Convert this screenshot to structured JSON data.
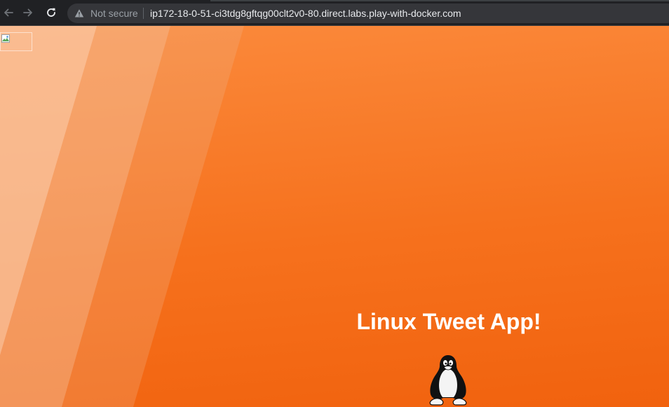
{
  "browser": {
    "security_label": "Not secure",
    "url": "ip172-18-0-51-ci3tdg8gftqg00clt2v0-80.direct.labs.play-with-docker.com",
    "icons": {
      "back": "arrow-left-icon",
      "forward": "arrow-right-icon",
      "reload": "reload-icon",
      "security": "warning-triangle-icon"
    }
  },
  "page": {
    "title": "Linux Tweet App!",
    "logo": "tux-penguin-icon",
    "broken_image": "broken-image-icon",
    "colors": {
      "background_top": "#fb8a3c",
      "background_bottom": "#f1620e",
      "title": "#ffffff"
    }
  }
}
